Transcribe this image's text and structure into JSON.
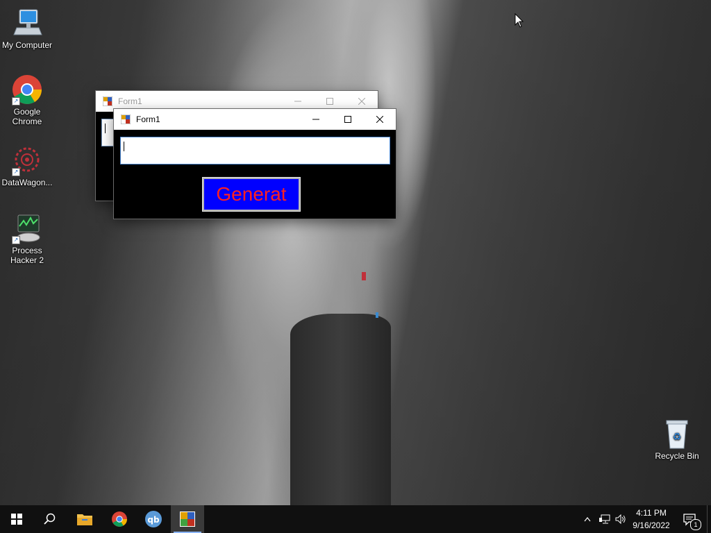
{
  "desktop": {
    "icons": [
      {
        "label": "My Computer"
      },
      {
        "label": "Google Chrome"
      },
      {
        "label": "DataWagon..."
      },
      {
        "label": "Process Hacker 2"
      },
      {
        "label": "Recycle Bin"
      }
    ]
  },
  "back_window": {
    "title": "Form1"
  },
  "front_window": {
    "title": "Form1",
    "input_value": "",
    "generate_label": "Generat"
  },
  "taskbar": {
    "time": "4:11 PM",
    "date": "9/16/2022",
    "notification_count": "1",
    "pinned": [
      "start",
      "search",
      "file-explorer",
      "chrome",
      "qbittorrent",
      "form-app"
    ]
  },
  "colors": {
    "button_bg": "#0000ff",
    "button_text": "#ff2020",
    "form_bg": "#000000",
    "taskbar_bg": "#101010"
  }
}
